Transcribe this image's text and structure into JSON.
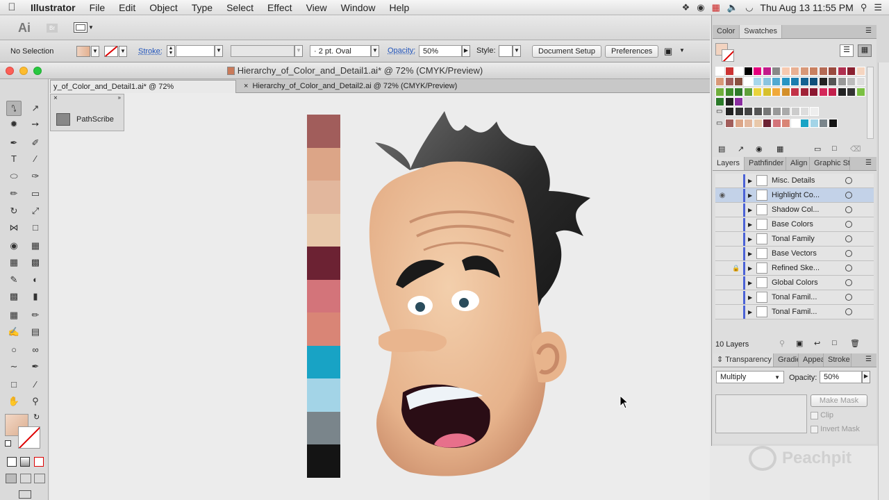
{
  "menubar": {
    "apple": "",
    "app": "Illustrator",
    "items": [
      "File",
      "Edit",
      "Object",
      "Type",
      "Select",
      "Effect",
      "View",
      "Window",
      "Help"
    ],
    "clock": "Thu Aug 13  11:55 PM"
  },
  "appbar": {
    "logo": "Ai",
    "bridge": "Br"
  },
  "control": {
    "selection": "No Selection",
    "stroke_label": "Stroke:",
    "brush": "2 pt. Oval",
    "opacity_label": "Opacity:",
    "opacity": "50%",
    "style_label": "Style:",
    "doc_setup": "Document Setup",
    "preferences": "Preferences"
  },
  "window": {
    "title": "Hierarchy_of_Color_and_Detail1.ai* @ 72% (CMYK/Preview)"
  },
  "tabs": [
    {
      "label": "y_of_Color_and_Detail1.ai* @ 72% (CMYK/Preview)"
    },
    {
      "label": "Hierarchy_of_Color_and_Detail2.ai @ 72% (CMYK/Preview)"
    }
  ],
  "pathscribe": {
    "label": "PathScribe"
  },
  "palette": [
    "#a15d5b",
    "#dca587",
    "#e2b79d",
    "#e8c8aa",
    "#6c2233",
    "#d3747a",
    "#d98576",
    "#18a3c5",
    "#a3d4e7",
    "#7a858b",
    "#141414"
  ],
  "color_panel": {
    "tabs": [
      "Color",
      "Swatches"
    ],
    "swatch_rows": [
      [
        "#ffffff",
        "#cc3333",
        "#ffffff",
        "#000000",
        "#e5007d",
        "#c21a8a",
        "#888888",
        "#f6c9b0",
        "#e8b093",
        "#d89878",
        "#c88060",
        "#b46a55",
        "#9a4a3f",
        "#b03050",
        "#8a2030",
        "#f5d5c0"
      ],
      [
        "#d89878",
        "#a15d5b",
        "#8a5040",
        "#ffffff",
        "#a6d7ec",
        "#8ac4e0",
        "#50a9d1",
        "#2794c3",
        "#1b7cae",
        "#146191",
        "#0f4f7a",
        "#222222",
        "#555555",
        "#999999",
        "#bbbbbb",
        "#dddddd"
      ],
      [
        "#6fae3b",
        "#3f8c2c",
        "#2f7a2a",
        "#5fa03a",
        "#e9d33b",
        "#d7c02c",
        "#f0a93a",
        "#d38f2a",
        "#c23247",
        "#a02237",
        "#8b1730",
        "#d4285a",
        "#c21f4b",
        "#222222",
        "#333333",
        "#7bc043"
      ],
      [
        "#2b7a2a",
        "#222222",
        "#8a2ca0"
      ],
      [
        "#222222",
        "#333333",
        "#444444",
        "#555555",
        "#777777",
        "#999999",
        "#aaaaaa",
        "#cccccc",
        "#dddddd",
        "#eeeeee"
      ],
      [
        "#a15d5b",
        "#dca587",
        "#e2b79d",
        "#e8c8aa",
        "#6c2233",
        "#d3747a",
        "#d98576",
        "#ffffff",
        "#18a3c5",
        "#a3d4e7",
        "#7a858b",
        "#141414"
      ]
    ]
  },
  "layers_panel": {
    "tabs": [
      "Layers",
      "Pathfinder",
      "Align",
      "Graphic St"
    ],
    "layers": [
      {
        "name": "Misc. Details",
        "visible": false,
        "locked": false,
        "highlight": false
      },
      {
        "name": "Highlight Co...",
        "visible": true,
        "locked": false,
        "highlight": true
      },
      {
        "name": "Shadow Col...",
        "visible": false,
        "locked": false,
        "highlight": false
      },
      {
        "name": "Base Colors",
        "visible": false,
        "locked": false,
        "highlight": false
      },
      {
        "name": "Tonal Family",
        "visible": false,
        "locked": false,
        "highlight": false
      },
      {
        "name": "Base Vectors",
        "visible": false,
        "locked": false,
        "highlight": false
      },
      {
        "name": "Refined Ske...",
        "visible": false,
        "locked": true,
        "highlight": false
      },
      {
        "name": "Global Colors",
        "visible": false,
        "locked": false,
        "highlight": false
      },
      {
        "name": "Tonal Famil...",
        "visible": false,
        "locked": false,
        "highlight": false
      },
      {
        "name": "Tonal Famil...",
        "visible": false,
        "locked": false,
        "highlight": false
      }
    ],
    "count": "10 Layers"
  },
  "transparency_panel": {
    "tabs": [
      "Transparency",
      "Gradie",
      "Appea",
      "Stroke"
    ],
    "mode": "Multiply",
    "opacity_label": "Opacity:",
    "opacity": "50%",
    "make_mask": "Make Mask",
    "clip": "Clip",
    "invert_mask": "Invert Mask"
  },
  "watermark": "Peachpit",
  "colors": {
    "highlight_row": "#c3d2e8",
    "layer_bar": "#4b62d6",
    "skin": "#e8b88f",
    "hair": "#1d1d1d"
  }
}
